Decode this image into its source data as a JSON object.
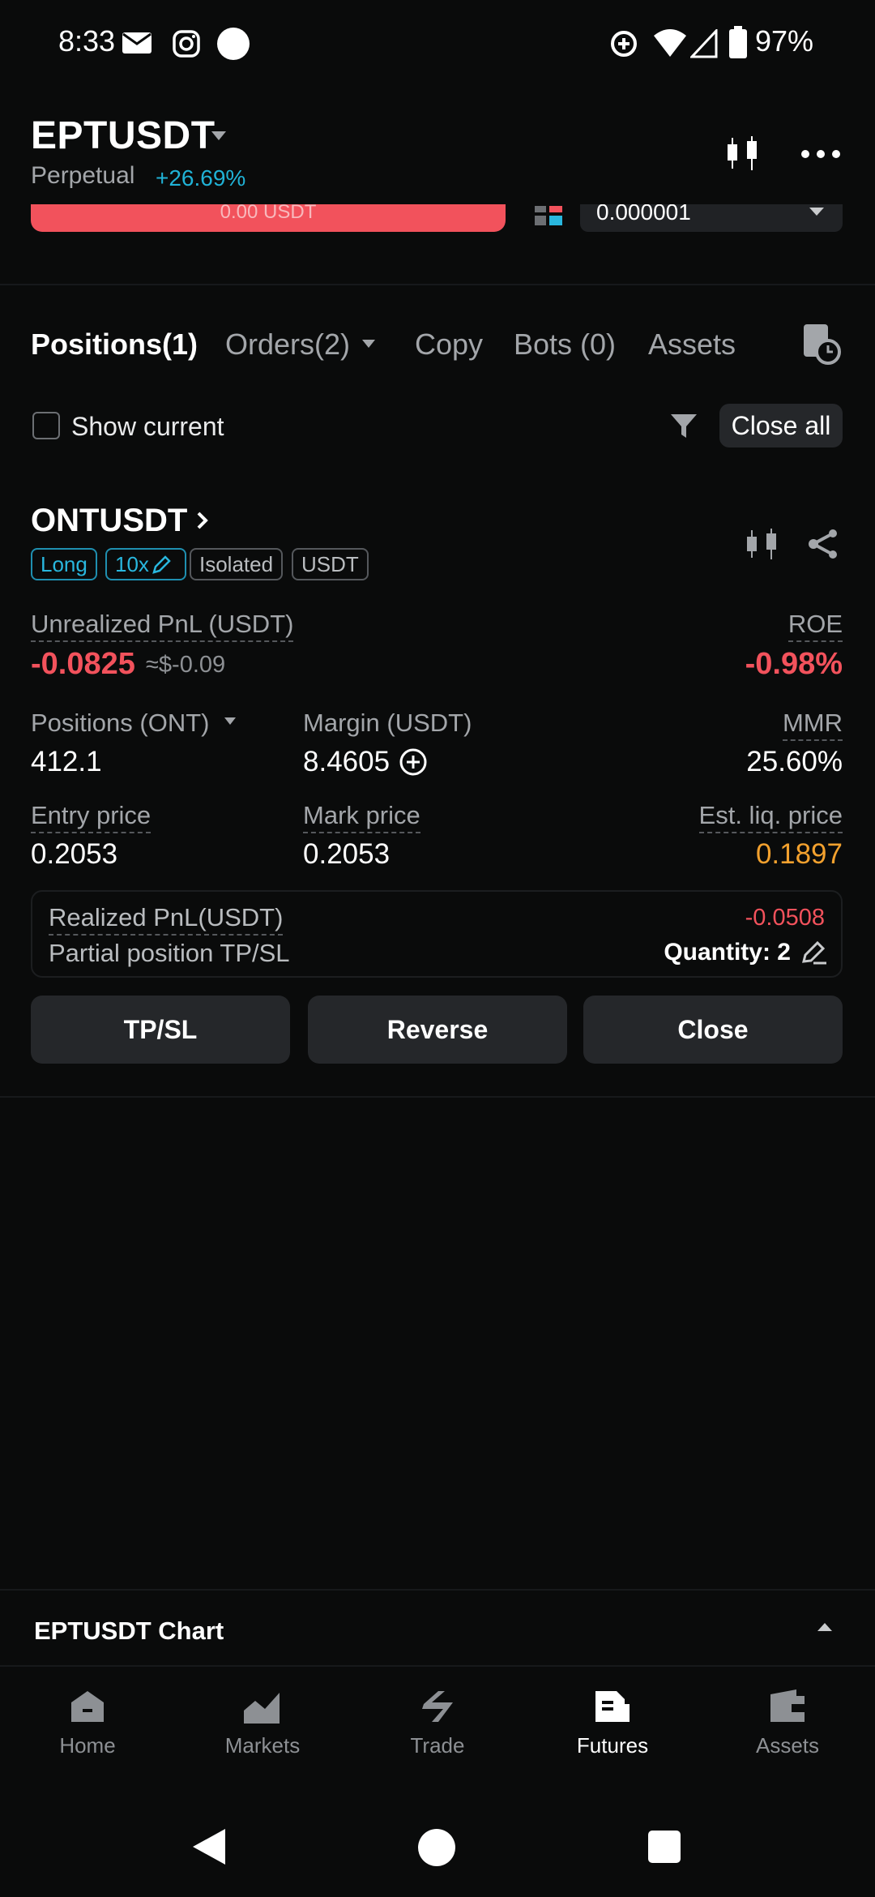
{
  "status_bar": {
    "time": "8:33",
    "battery": "97%"
  },
  "header": {
    "symbol": "EPTUSDT",
    "subtitle": "Perpetual",
    "change": "+26.69%"
  },
  "order_row": {
    "red_bar_text": "0.00 USDT",
    "input_value": "0.000001"
  },
  "tabs": [
    {
      "label": "Positions(1)"
    },
    {
      "label": "Orders(2)"
    },
    {
      "label": "Copy"
    },
    {
      "label": "Bots (0)"
    },
    {
      "label": "Assets"
    }
  ],
  "filter": {
    "show_current": "Show current",
    "close_all": "Close all"
  },
  "position": {
    "symbol": "ONTUSDT",
    "tags": {
      "side": "Long",
      "leverage": "10x",
      "margin_mode": "Isolated",
      "currency": "USDT"
    },
    "unrealized_label": "Unrealized PnL (USDT)",
    "unrealized_value": "-0.0825",
    "unrealized_approx": "≈$-0.09",
    "roe_label": "ROE",
    "roe_value": "-0.98%",
    "positions_label": "Positions (ONT)",
    "positions_value": "412.1",
    "margin_label": "Margin (USDT)",
    "margin_value": "8.4605",
    "mmr_label": "MMR",
    "mmr_value": "25.60%",
    "entry_label": "Entry price",
    "entry_value": "0.2053",
    "mark_label": "Mark price",
    "mark_value": "0.2053",
    "liq_label": "Est. liq. price",
    "liq_value": "0.1897",
    "realized_label": "Realized PnL(USDT)",
    "realized_value": "-0.0508",
    "partial_label": "Partial position TP/SL",
    "quantity_label": "Quantity: 2",
    "buttons": {
      "tpsl": "TP/SL",
      "reverse": "Reverse",
      "close": "Close"
    }
  },
  "chart_bar": {
    "title": "EPTUSDT Chart"
  },
  "nav": [
    {
      "label": "Home"
    },
    {
      "label": "Markets"
    },
    {
      "label": "Trade"
    },
    {
      "label": "Futures"
    },
    {
      "label": "Assets"
    }
  ],
  "colors": {
    "accent_blue": "#29b7de",
    "negative": "#f2525c",
    "warning": "#f3a12e",
    "background": "#0a0b0b"
  }
}
